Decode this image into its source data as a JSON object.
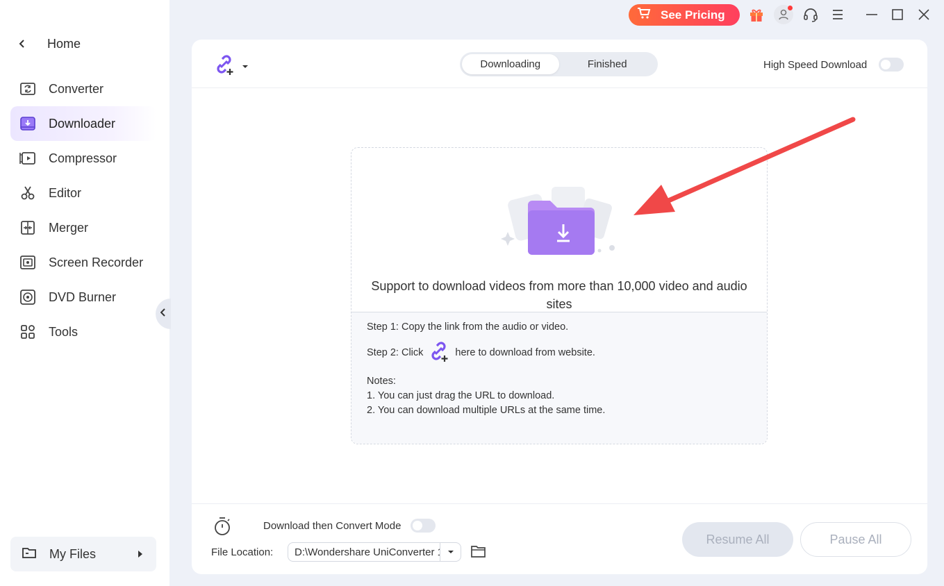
{
  "sidebar": {
    "home_label": "Home",
    "items": [
      {
        "label": "Converter"
      },
      {
        "label": "Downloader"
      },
      {
        "label": "Compressor"
      },
      {
        "label": "Editor"
      },
      {
        "label": "Merger"
      },
      {
        "label": "Screen Recorder"
      },
      {
        "label": "DVD Burner"
      },
      {
        "label": "Tools"
      }
    ],
    "active_item": "Downloader",
    "my_files_label": "My Files"
  },
  "topbar": {
    "pricing_label": "See Pricing",
    "accent_gradient": [
      "#ff6a3a",
      "#ff3f5e"
    ]
  },
  "header": {
    "tabs": [
      {
        "label": "Downloading"
      },
      {
        "label": "Finished"
      }
    ],
    "active_tab": "Downloading",
    "high_speed_label": "High Speed Download",
    "high_speed_enabled": false
  },
  "dropzone": {
    "support_text": "Support to download videos from more than 10,000 video and audio sites",
    "step1": "Step 1: Copy the link from the audio or video.",
    "step2_prefix": "Step 2: Click",
    "step2_suffix": "here to download from website.",
    "notes_title": "Notes:",
    "note1": "1. You can just drag the URL to download.",
    "note2": "2. You can download multiple URLs at the same time."
  },
  "footer": {
    "convert_mode_label": "Download then Convert Mode",
    "convert_mode_enabled": false,
    "file_location_label": "File Location:",
    "file_location_value": "D:\\Wondershare UniConverter 1",
    "resume_label": "Resume All",
    "pause_label": "Pause All"
  },
  "colors": {
    "brand_purple": "#8a63f5",
    "annotation_arrow": "#f04848"
  }
}
